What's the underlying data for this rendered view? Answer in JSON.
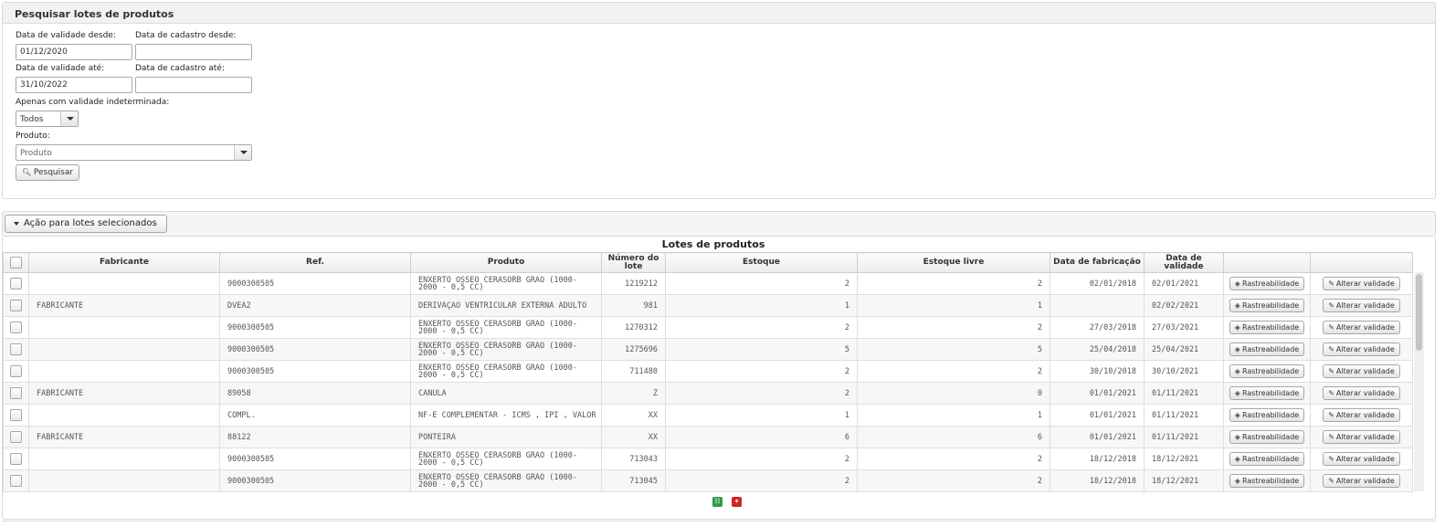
{
  "search_panel": {
    "title": "Pesquisar lotes de produtos",
    "validade_desde_label": "Data de validade desde:",
    "validade_desde_value": "01/12/2020",
    "cadastro_desde_label": "Data de cadastro desde:",
    "cadastro_desde_value": "",
    "validade_ate_label": "Data de validade até:",
    "validade_ate_value": "31/10/2022",
    "cadastro_ate_label": "Data de cadastro até:",
    "cadastro_ate_value": "",
    "indeterminada_label": "Apenas com validade indeterminada:",
    "indeterminada_value": "Todos",
    "produto_label": "Produto:",
    "produto_placeholder": "Produto",
    "search_button": "Pesquisar"
  },
  "action_panel": {
    "button_label": "Ação para lotes selecionados"
  },
  "table": {
    "title": "Lotes de produtos",
    "columns": {
      "fabricante": "Fabricante",
      "ref": "Ref.",
      "produto": "Produto",
      "numero_lote": "Número do lote",
      "estoque": "Estoque",
      "estoque_livre": "Estoque livre",
      "data_fabricacao": "Data de fabricação",
      "data_validade": "Data de validade"
    },
    "rastreabilidade_label": "Rastreabilidade",
    "alterar_validade_label": "Alterar validade",
    "rows": [
      {
        "fabricante": "",
        "ref": "9000300505",
        "produto": "ENXERTO OSSEO CERASORB GRAO (1000-2000 - 0,5 CC)",
        "lote": "1219212",
        "estoque": "2",
        "livre": "2",
        "fabricacao": "02/01/2018",
        "validade": "02/01/2021"
      },
      {
        "fabricante": "FABRICANTE",
        "ref": "DVEA2",
        "produto": "DERIVAÇAO VENTRICULAR EXTERNA ADULTO",
        "lote": "981",
        "estoque": "1",
        "livre": "1",
        "fabricacao": "",
        "validade": "02/02/2021"
      },
      {
        "fabricante": "",
        "ref": "9000300505",
        "produto": "ENXERTO OSSEO CERASORB GRAO (1000-2000 - 0,5 CC)",
        "lote": "1270312",
        "estoque": "2",
        "livre": "2",
        "fabricacao": "27/03/2018",
        "validade": "27/03/2021"
      },
      {
        "fabricante": "",
        "ref": "9000300505",
        "produto": "ENXERTO OSSEO CERASORB GRAO (1000-2000 - 0,5 CC)",
        "lote": "1275696",
        "estoque": "5",
        "livre": "5",
        "fabricacao": "25/04/2018",
        "validade": "25/04/2021"
      },
      {
        "fabricante": "",
        "ref": "9000300505",
        "produto": "ENXERTO OSSEO CERASORB GRAO (1000-2000 - 0,5 CC)",
        "lote": "711480",
        "estoque": "2",
        "livre": "2",
        "fabricacao": "30/10/2018",
        "validade": "30/10/2021"
      },
      {
        "fabricante": "FABRICANTE",
        "ref": "89058",
        "produto": "CANULA",
        "lote": "Z",
        "estoque": "2",
        "livre": "0",
        "fabricacao": "01/01/2021",
        "validade": "01/11/2021"
      },
      {
        "fabricante": "",
        "ref": "COMPL.",
        "produto": "NF-E COMPLEMENTAR - ICMS , IPI , VALOR",
        "lote": "XX",
        "estoque": "1",
        "livre": "1",
        "fabricacao": "01/01/2021",
        "validade": "01/11/2021"
      },
      {
        "fabricante": "FABRICANTE",
        "ref": "88122",
        "produto": "PONTEIRA",
        "lote": "XX",
        "estoque": "6",
        "livre": "6",
        "fabricacao": "01/01/2021",
        "validade": "01/11/2021"
      },
      {
        "fabricante": "",
        "ref": "9000300505",
        "produto": "ENXERTO OSSEO CERASORB GRAO (1000-2000 - 0,5 CC)",
        "lote": "713043",
        "estoque": "2",
        "livre": "2",
        "fabricacao": "18/12/2018",
        "validade": "18/12/2021"
      },
      {
        "fabricante": "",
        "ref": "9000300505",
        "produto": "ENXERTO OSSEO CERASORB GRAO (1000-2000 - 0,5 CC)",
        "lote": "713045",
        "estoque": "2",
        "livre": "2",
        "fabricacao": "18/12/2018",
        "validade": "18/12/2021"
      }
    ]
  },
  "export": {
    "excel_icon": "excel-icon",
    "pdf_icon": "pdf-icon",
    "excel_color": "#2e9a4e",
    "pdf_color": "#d12424"
  }
}
